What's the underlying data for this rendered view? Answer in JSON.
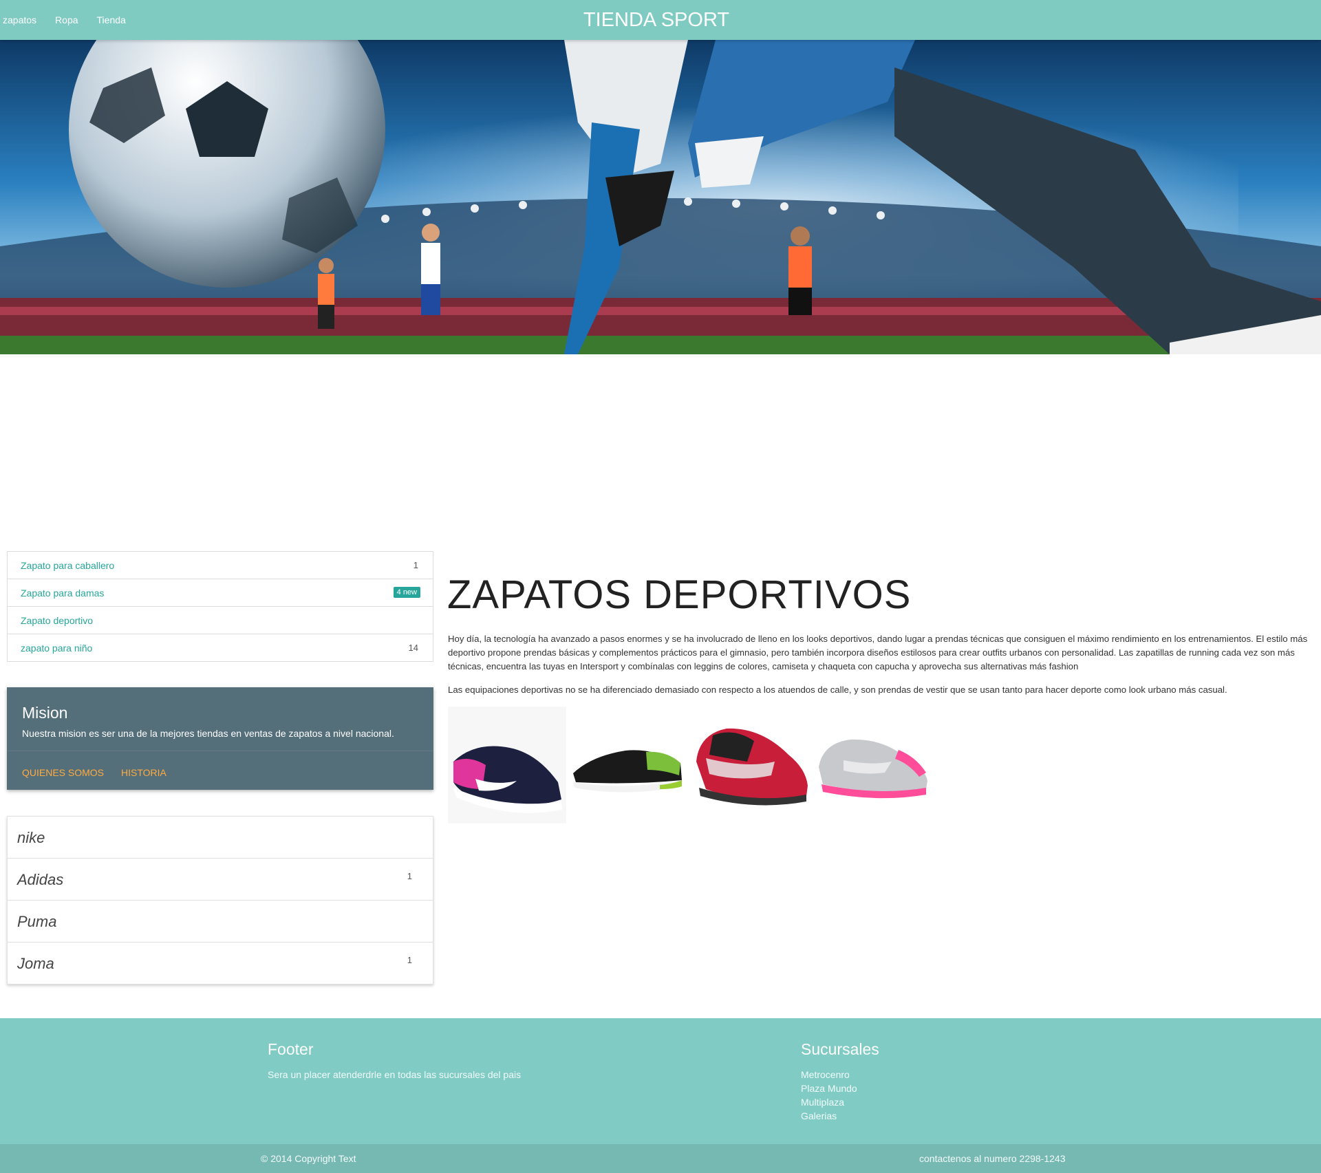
{
  "nav": {
    "links": [
      "zapatos",
      "Ropa",
      "Tienda"
    ],
    "brand": "TIENDA SPORT"
  },
  "hero": {
    "image": "soccer-stadium-hero",
    "colors": {
      "sky": "#1c5c93",
      "pitch": "#3b7a2e"
    }
  },
  "categories": [
    {
      "label": "Zapato para caballero",
      "count": "1"
    },
    {
      "label": "Zapato para damas",
      "badge": "4 new"
    },
    {
      "label": "Zapato deportivo"
    },
    {
      "label": "zapato para niño",
      "count": "14"
    }
  ],
  "mision": {
    "title": "Mision",
    "text": "Nuestra mision es ser una de la mejores tiendas en ventas de zapatos a nivel nacional.",
    "links": [
      "QUIENES SOMOS",
      "HISTORIA"
    ]
  },
  "brands": [
    {
      "label": "nike"
    },
    {
      "label": "Adidas",
      "count": "1"
    },
    {
      "label": "Puma"
    },
    {
      "label": "Joma",
      "count": "1"
    }
  ],
  "main": {
    "heading": "ZAPATOS DEPORTIVOS",
    "paragraph1": "Hoy día, la tecnología ha avanzado a pasos enormes y se ha involucrado de lleno en los looks deportivos, dando lugar a prendas técnicas que consiguen el máximo rendimiento en los entrenamientos. El estilo más deportivo propone prendas básicas y complementos prácticos para el gimnasio, pero también incorpora diseños estilosos para crear outfits urbanos con personalidad. Las zapatillas de running cada vez son más técnicas, encuentra las tuyas en Intersport y combínalas con leggins de colores, camiseta y chaqueta con capucha y aprovecha sus alternativas más fashion",
    "paragraph2": "Las equipaciones deportivas no se ha diferenciado demasiado con respecto a los atuendos de calle, y son prendas de vestir que se usan tanto para hacer deporte como look urbano más casual.",
    "shoes": [
      "pink-navy-running-shoe",
      "black-green-running-shoe",
      "red-black-kids-shoe",
      "silver-pink-kids-shoe"
    ]
  },
  "footer": {
    "title": "Footer",
    "text": "Sera un placer atenderdrle en todas las sucursales del pais",
    "branches_title": "Sucursales",
    "branches": [
      "Metrocenro",
      "Plaza Mundo",
      "Multiplaza",
      "Galerias"
    ],
    "copyright": "© 2014 Copyright Text",
    "contact": "contactenos al numero 2298-1243"
  }
}
